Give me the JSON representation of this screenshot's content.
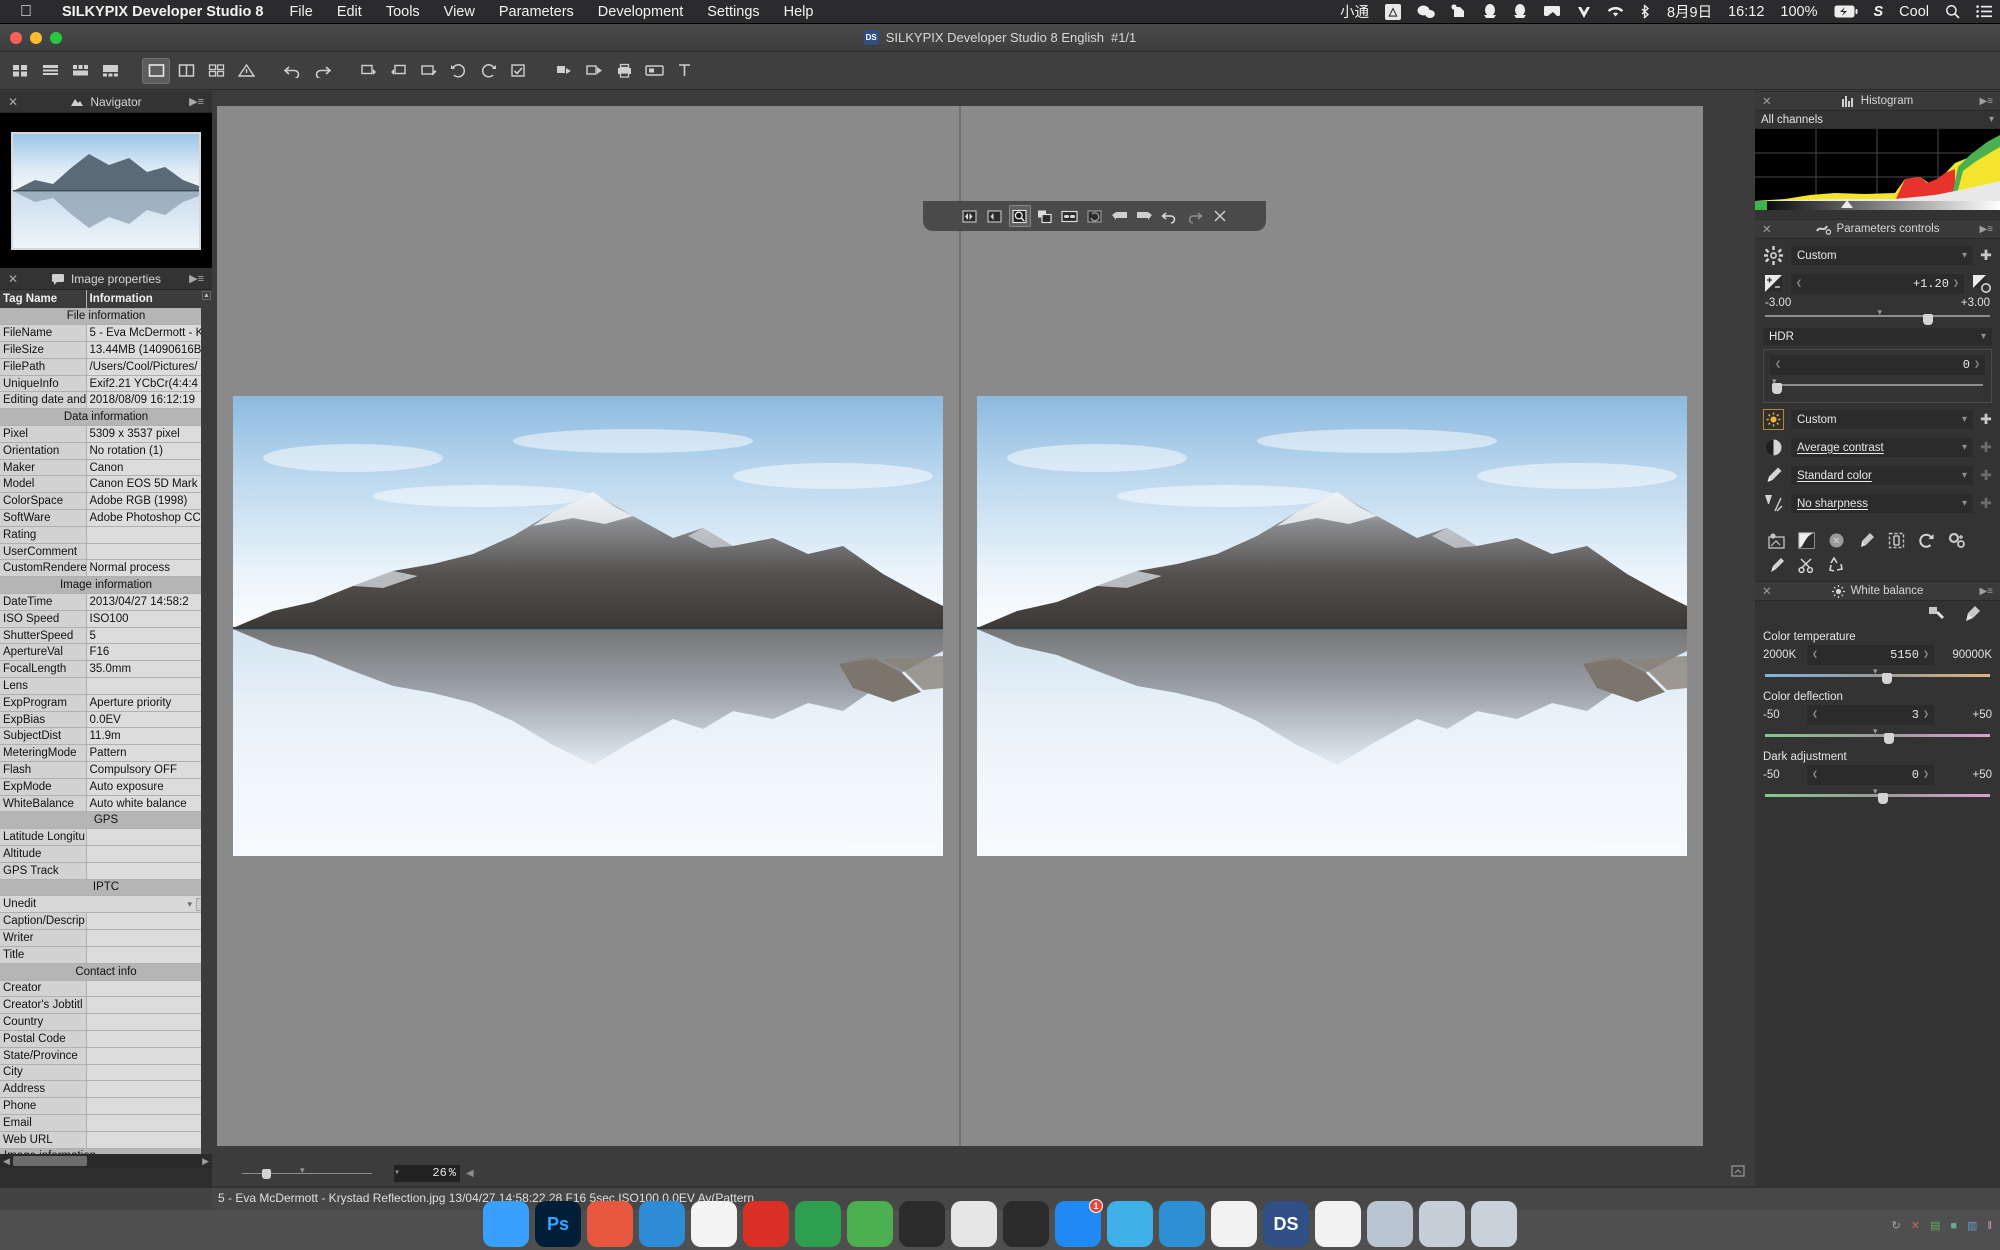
{
  "menubar": {
    "apple_icon": "apple-icon",
    "app_name": "SILKYPIX Developer Studio 8",
    "menus": [
      "File",
      "Edit",
      "Tools",
      "View",
      "Parameters",
      "Development",
      "Settings",
      "Help"
    ],
    "right_items": [
      {
        "name": "input-method",
        "label": "小通"
      },
      {
        "name": "google-drive-icon",
        "label": ""
      },
      {
        "name": "wechat-icon",
        "label": ""
      },
      {
        "name": "evernote-icon",
        "label": ""
      },
      {
        "name": "qq-icon-1",
        "label": ""
      },
      {
        "name": "qq-icon-2",
        "label": ""
      },
      {
        "name": "airplay-icon",
        "label": ""
      },
      {
        "name": "vpn-icon",
        "label": ""
      },
      {
        "name": "wifi-icon",
        "label": ""
      },
      {
        "name": "bluetooth-icon",
        "label": ""
      }
    ],
    "date": "8月9日",
    "time": "16:12",
    "battery_percent": "100%",
    "user": "Cool",
    "search_icon": "search-icon",
    "notification_icon": "notification-center-icon"
  },
  "window": {
    "title": "SILKYPIX Developer Studio 8 English",
    "counter": "#1/1",
    "badge": "DS",
    "lights": {
      "close": "#ff5f57",
      "minimize": "#febc2e",
      "zoom": "#28c840"
    }
  },
  "toolbar": {
    "buttons": [
      {
        "name": "thumbnail-view-button",
        "icon": "grid-small",
        "active": false
      },
      {
        "name": "list-view-button",
        "icon": "list",
        "active": false
      },
      {
        "name": "combination-view-button",
        "icon": "grid4",
        "active": false
      },
      {
        "name": "filmstrip-view-button",
        "icon": "filmstrip",
        "active": false
      },
      {
        "name": "single-preview-button",
        "icon": "single-frame",
        "active": true
      },
      {
        "name": "split-preview-button",
        "icon": "split-frame",
        "active": false
      },
      {
        "name": "multi-preview-button",
        "icon": "multi-frame",
        "active": false
      },
      {
        "name": "warning-button",
        "icon": "warning-triangle",
        "active": false
      },
      {
        "name": "undo-button",
        "icon": "undo-arrow",
        "active": false
      },
      {
        "name": "redo-button",
        "icon": "redo-arrow",
        "active": false
      },
      {
        "name": "taste-copy-button",
        "icon": "taste-copy",
        "active": false
      },
      {
        "name": "taste-paste-button",
        "icon": "taste-paste",
        "active": false
      },
      {
        "name": "taste-edit-button",
        "icon": "taste-edit",
        "active": false
      },
      {
        "name": "rotate-left-button",
        "icon": "rotate-left",
        "active": false
      },
      {
        "name": "rotate-right-button",
        "icon": "rotate-right",
        "active": false
      },
      {
        "name": "mark-button",
        "icon": "checkbox",
        "active": false
      },
      {
        "name": "batch-develop-button",
        "icon": "batch-develop",
        "active": false
      },
      {
        "name": "develop-button",
        "icon": "develop",
        "active": false
      },
      {
        "name": "print-button",
        "icon": "printer",
        "active": false
      },
      {
        "name": "slideshow-button",
        "icon": "slideshow",
        "active": false
      },
      {
        "name": "crop-button",
        "icon": "crop-tool",
        "active": false
      }
    ]
  },
  "navigator": {
    "title": "Navigator",
    "icon": "navigator-icon"
  },
  "image_properties": {
    "title": "Image properties",
    "icon": "properties-icon",
    "columns": [
      "Tag Name",
      "Information"
    ],
    "groups": [
      {
        "header": "File information",
        "rows": [
          {
            "tag": "FileName",
            "value": "5 - Eva McDermott - K"
          },
          {
            "tag": "FileSize",
            "value": "13.44MB (14090616B"
          },
          {
            "tag": "FilePath",
            "value": "/Users/Cool/Pictures/"
          },
          {
            "tag": "UniqueInfo",
            "value": "Exif2.21 YCbCr(4:4:4"
          },
          {
            "tag": "Editing date and",
            "value": "2018/08/09 16:12:19"
          }
        ]
      },
      {
        "header": "Data information",
        "rows": [
          {
            "tag": "Pixel",
            "value": "5309 x 3537 pixel"
          },
          {
            "tag": "Orientation",
            "value": "No rotation (1)"
          },
          {
            "tag": "Maker",
            "value": "Canon"
          },
          {
            "tag": "Model",
            "value": "Canon EOS 5D Mark"
          },
          {
            "tag": "ColorSpace",
            "value": "Adobe RGB (1998)"
          },
          {
            "tag": "SoftWare",
            "value": "Adobe Photoshop CC"
          },
          {
            "tag": "Rating",
            "value": "",
            "dot": true
          },
          {
            "tag": "UserComment",
            "value": "",
            "dot": true
          },
          {
            "tag": "CustomRendered",
            "value": "Normal process"
          }
        ]
      },
      {
        "header": "Image information",
        "rows": [
          {
            "tag": "DateTime",
            "value": "2013/04/27 14:58:2",
            "dot": true
          },
          {
            "tag": "ISO Speed",
            "value": "ISO100",
            "dot": true
          },
          {
            "tag": "ShutterSpeed",
            "value": "5",
            "dot": true
          },
          {
            "tag": "ApertureVal",
            "value": "F16",
            "dot": true
          },
          {
            "tag": "FocalLength",
            "value": "35.0mm",
            "dot": true
          },
          {
            "tag": "Lens",
            "value": "",
            "dot": true
          },
          {
            "tag": "ExpProgram",
            "value": "Aperture priority"
          },
          {
            "tag": "ExpBias",
            "value": "0.0EV"
          },
          {
            "tag": "SubjectDist",
            "value": "11.9m"
          },
          {
            "tag": "MeteringMode",
            "value": "Pattern"
          },
          {
            "tag": "Flash",
            "value": "Compulsory OFF"
          },
          {
            "tag": "ExpMode",
            "value": "Auto exposure"
          },
          {
            "tag": "WhiteBalance",
            "value": "Auto white balance"
          }
        ]
      },
      {
        "header": "GPS",
        "rows": [
          {
            "tag": "Latitude Longitu",
            "value": "",
            "dot": true
          },
          {
            "tag": "Altitude",
            "value": "",
            "dot": true
          },
          {
            "tag": "GPS Track",
            "value": "",
            "dot": true
          }
        ]
      },
      {
        "header": "IPTC",
        "rows": [
          {
            "tag": "__iptc_select__",
            "value": "Unedit"
          },
          {
            "tag": "Caption/Descrip",
            "value": "",
            "dot": true
          },
          {
            "tag": "Writer",
            "value": "",
            "dot": true
          },
          {
            "tag": "Title",
            "value": "",
            "dot": true
          }
        ]
      },
      {
        "header": "Contact info",
        "rows": [
          {
            "tag": "Creator",
            "value": "",
            "dot": true
          },
          {
            "tag": "Creator's Jobtitl",
            "value": "",
            "dot": true
          },
          {
            "tag": "Country",
            "value": "",
            "dot": true
          },
          {
            "tag": "Postal Code",
            "value": "",
            "dot": true
          },
          {
            "tag": "State/Province",
            "value": "",
            "dot": true
          },
          {
            "tag": "City",
            "value": "",
            "dot": true
          },
          {
            "tag": "Address",
            "value": "",
            "dot": true
          },
          {
            "tag": "Phone",
            "value": "",
            "dot": true
          },
          {
            "tag": "Email",
            "value": "",
            "dot": true
          },
          {
            "tag": "Web URL",
            "value": "",
            "dot": true
          }
        ]
      }
    ],
    "footer_row": "Image information",
    "iptc_value": "Unedit"
  },
  "preview": {
    "watermark": "© EVA MCDERMOTT",
    "float_toolbar": [
      {
        "name": "previous-compare-button",
        "icon": "prev-compare",
        "active": false
      },
      {
        "name": "next-compare-button",
        "icon": "next-compare",
        "active": false
      },
      {
        "name": "zoom-tool-button",
        "icon": "magnifier",
        "active": true
      },
      {
        "name": "compare-overlay-button",
        "icon": "overlay-compare",
        "active": false
      },
      {
        "name": "link-panes-button",
        "icon": "link-panes",
        "active": false
      },
      {
        "name": "sync-zoom-button",
        "icon": "sync-zoom",
        "active": false
      },
      {
        "name": "move-left-button",
        "icon": "arrow-left-flag",
        "active": false
      },
      {
        "name": "move-right-button",
        "icon": "arrow-right-flag",
        "active": false
      },
      {
        "name": "undo-preview-button",
        "icon": "undo-arrow",
        "active": false
      },
      {
        "name": "redo-preview-button",
        "icon": "redo-arrow",
        "active": false
      },
      {
        "name": "close-compare-button",
        "icon": "close-icon",
        "active": false
      }
    ],
    "zoom_value": "26",
    "zoom_unit": "%"
  },
  "statusbar": {
    "text": "5 - Eva McDermott - Krystad Reflection.jpg 13/04/27 14:58:22.28 F16 5sec ISO100  0.0EV Av(Pattern"
  },
  "histogram": {
    "title": "Histogram",
    "icon": "histogram-icon",
    "channel": "All channels"
  },
  "parameters_controls": {
    "title": "Parameters controls",
    "icon": "parameters-icon",
    "taste_preset": "Custom",
    "exposure": {
      "icon": "exposure-icon",
      "value": "+1.20",
      "min": "-3.00",
      "max": "+3.00",
      "reset_icon": "exposure-reset-icon"
    },
    "hdr": {
      "label": "HDR",
      "value": "0"
    },
    "tone_rows": [
      {
        "name": "tone-preset",
        "icon": "sun-icon",
        "label": "Custom",
        "underline": false,
        "accent": true,
        "plus_dim": false
      },
      {
        "name": "contrast-preset",
        "icon": "contrast-icon",
        "label": "Average contrast",
        "underline": true,
        "accent": false,
        "plus_dim": true
      },
      {
        "name": "color-preset",
        "icon": "color-icon",
        "label": "Standard color",
        "underline": true,
        "accent": false,
        "plus_dim": true
      },
      {
        "name": "sharpness-preset",
        "icon": "sharpness-icon",
        "label": "No sharpness",
        "underline": true,
        "accent": false,
        "plus_dim": true
      }
    ],
    "tool_icons": [
      "highlight-controller-icon",
      "tone-curve-icon",
      "dodge-burn-icon",
      "fine-color-icon",
      "noise-reduction-icon",
      "rotate-reset-icon",
      "effects-icon",
      "brush-icon",
      "spot-removal-icon",
      "recycle-icon"
    ]
  },
  "white_balance": {
    "title": "White balance",
    "icon": "white-balance-icon",
    "tools": [
      "gray-balance-picker-icon",
      "skin-color-picker-icon"
    ],
    "sliders": [
      {
        "name": "color-temperature",
        "label": "Color temperature",
        "min": "2000K",
        "value": "5150",
        "max": "90000K",
        "knob_pct": 52,
        "ramp": "temp"
      },
      {
        "name": "color-deflection",
        "label": "Color deflection",
        "min": "-50",
        "value": "3",
        "max": "+50",
        "knob_pct": 53,
        "ramp": "defl"
      },
      {
        "name": "dark-adjustment",
        "label": "Dark adjustment",
        "min": "-50",
        "value": "0",
        "max": "+50",
        "knob_pct": 50,
        "ramp": "defl"
      }
    ]
  },
  "dock": {
    "items": [
      {
        "name": "finder",
        "label": "",
        "color": "#3aa0ff"
      },
      {
        "name": "photoshop",
        "label": "Ps",
        "color": "#001e36"
      },
      {
        "name": "app-3",
        "label": "",
        "color": "#e8573f"
      },
      {
        "name": "safari",
        "label": "",
        "color": "#2e8bd6"
      },
      {
        "name": "chrome",
        "label": "",
        "color": "#f4f4f4"
      },
      {
        "name": "app-6",
        "label": "",
        "color": "#d93025"
      },
      {
        "name": "app-7",
        "label": "",
        "color": "#2e9e4f"
      },
      {
        "name": "wechat",
        "label": "",
        "color": "#4caf50"
      },
      {
        "name": "qq-1",
        "label": "",
        "color": "#2b2b2b"
      },
      {
        "name": "sketch",
        "label": "",
        "color": "#e6e6e6"
      },
      {
        "name": "qq-2",
        "label": "",
        "color": "#2b2b2b"
      },
      {
        "name": "app-store",
        "label": "",
        "color": "#2089f3",
        "badge": "1"
      },
      {
        "name": "app-12",
        "label": "",
        "color": "#3fb0e8"
      },
      {
        "name": "onedrive",
        "label": "",
        "color": "#2d8fd4"
      },
      {
        "name": "pages",
        "label": "",
        "color": "#f2f2f2"
      },
      {
        "name": "silkypix",
        "label": "DS",
        "color": "#2f4f86"
      },
      {
        "name": "info-app",
        "label": "",
        "color": "#f2f2f2"
      },
      {
        "name": "documents-folder",
        "label": "",
        "color": "#b9c6d2"
      },
      {
        "name": "downloads-folder",
        "label": "",
        "color": "#c6cfd8"
      },
      {
        "name": "trash",
        "label": "",
        "color": "#c9d2da"
      }
    ]
  },
  "tray": {
    "icons": [
      "sync-icon",
      "close-small-icon",
      "stack-icon",
      "swatch-icon",
      "chart-icon",
      "bar-icon"
    ]
  }
}
